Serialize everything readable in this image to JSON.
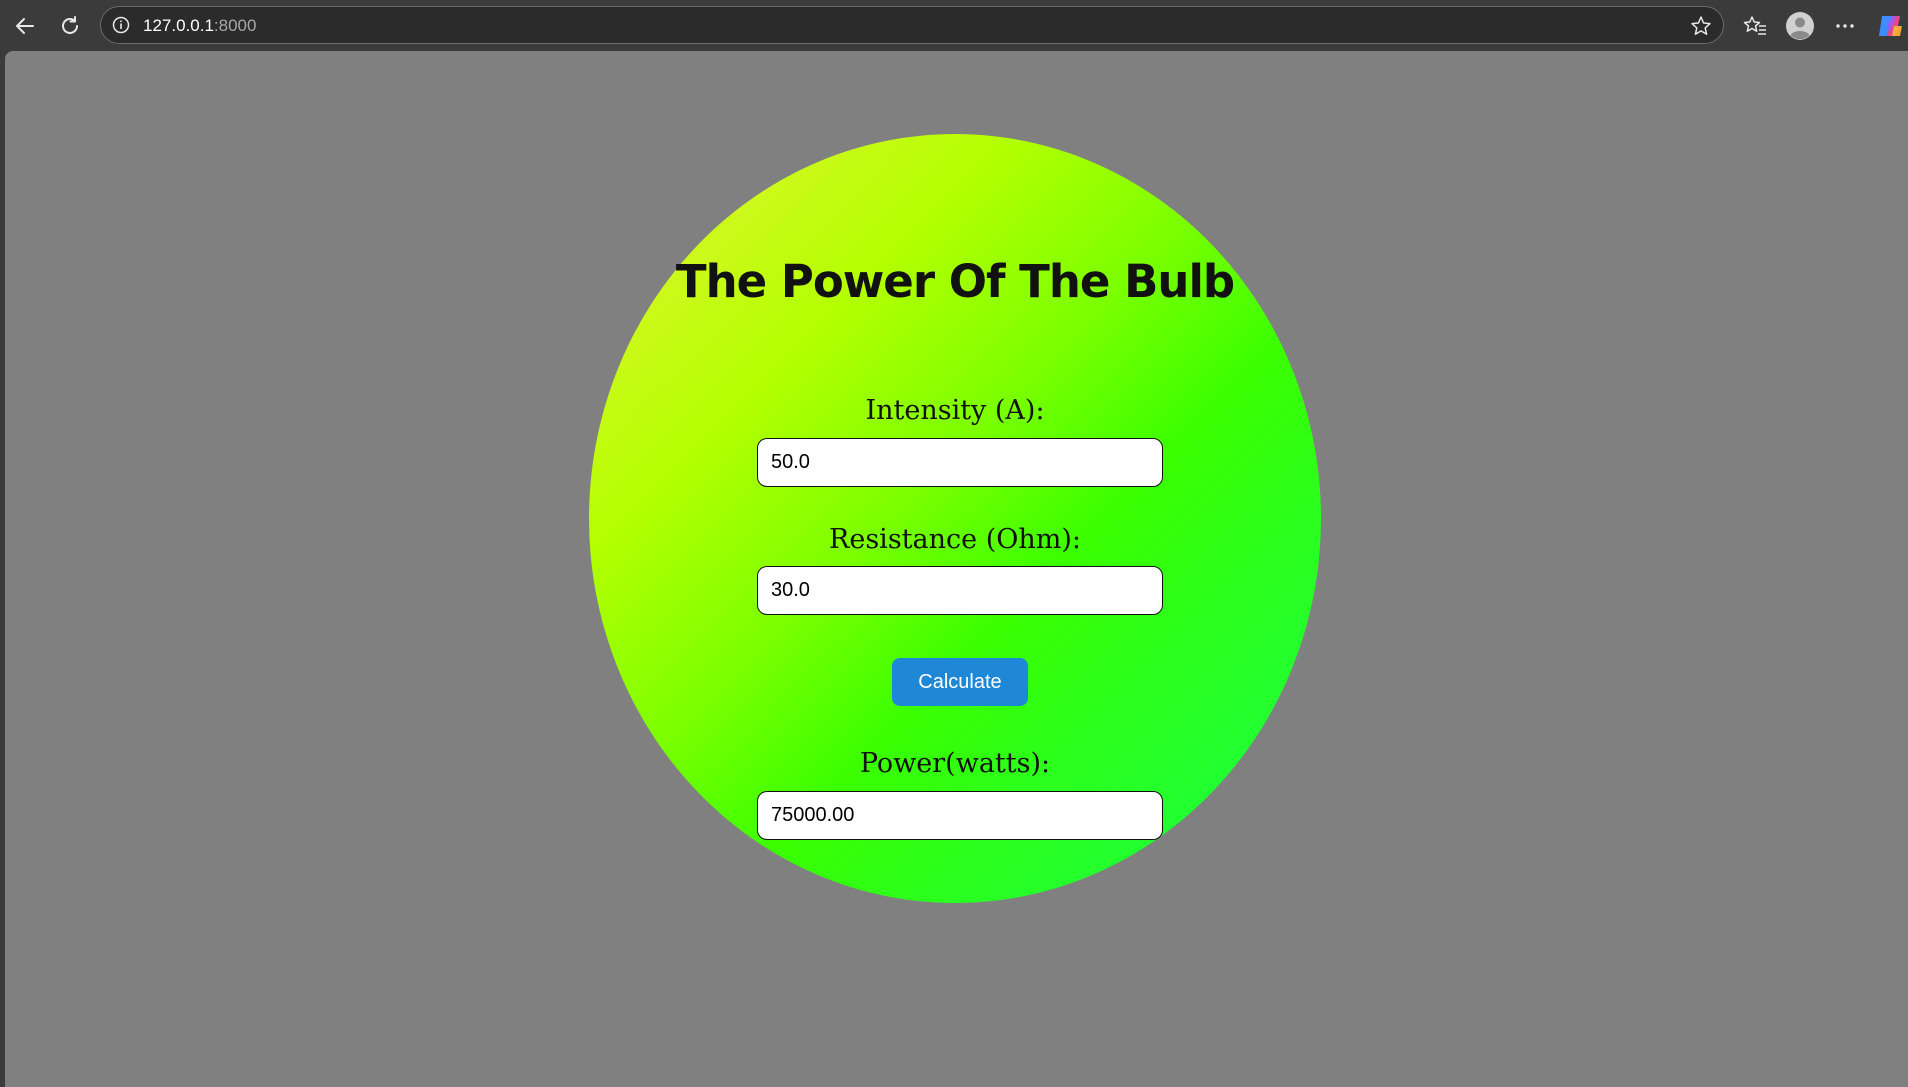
{
  "browser": {
    "url_host": "127.0.0.1",
    "url_port": ":8000",
    "icons": [
      "back-arrow-icon",
      "refresh-icon",
      "info-icon",
      "star-icon",
      "favorites-icon",
      "profile-icon",
      "more-icon",
      "copilot-icon"
    ]
  },
  "page": {
    "title": "The Power Of The Bulb",
    "intensity_label": "Intensity (A):",
    "intensity_value": "50.0",
    "resistance_label": "Resistance (Ohm):",
    "resistance_value": "30.0",
    "calculate_label": "Calculate",
    "power_label": "Power(watts):",
    "power_value": "75000.00"
  },
  "colors": {
    "page_background": "#808080",
    "button": "#1e88d6",
    "bulb_gradient": [
      "#e8f23a",
      "#b4ff00",
      "#3aff00",
      "#1aff20"
    ]
  }
}
